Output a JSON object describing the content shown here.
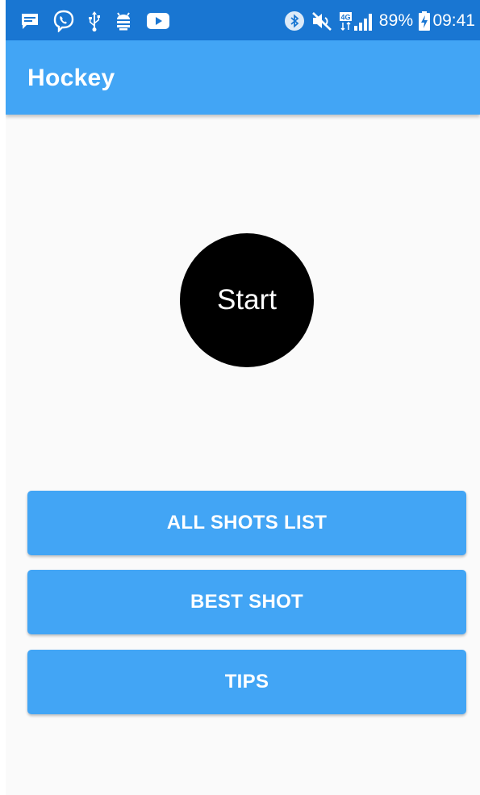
{
  "status_bar": {
    "icons_left": [
      "message-icon",
      "viber-icon",
      "usb-icon",
      "android-debug-icon",
      "youtube-icon"
    ],
    "icons_right": [
      "bluetooth-icon",
      "mute-icon",
      "4g-signal-icon"
    ],
    "battery_percent": "89%",
    "time": "09:41"
  },
  "app_bar": {
    "title": "Hockey"
  },
  "main": {
    "start_label": "Start",
    "buttons": [
      {
        "label": "ALL SHOTS LIST"
      },
      {
        "label": "BEST SHOT"
      },
      {
        "label": "TIPS"
      }
    ]
  },
  "colors": {
    "status_bar": "#1976d2",
    "primary": "#42a5f5",
    "background": "#fafafa",
    "start_circle": "#000000"
  }
}
